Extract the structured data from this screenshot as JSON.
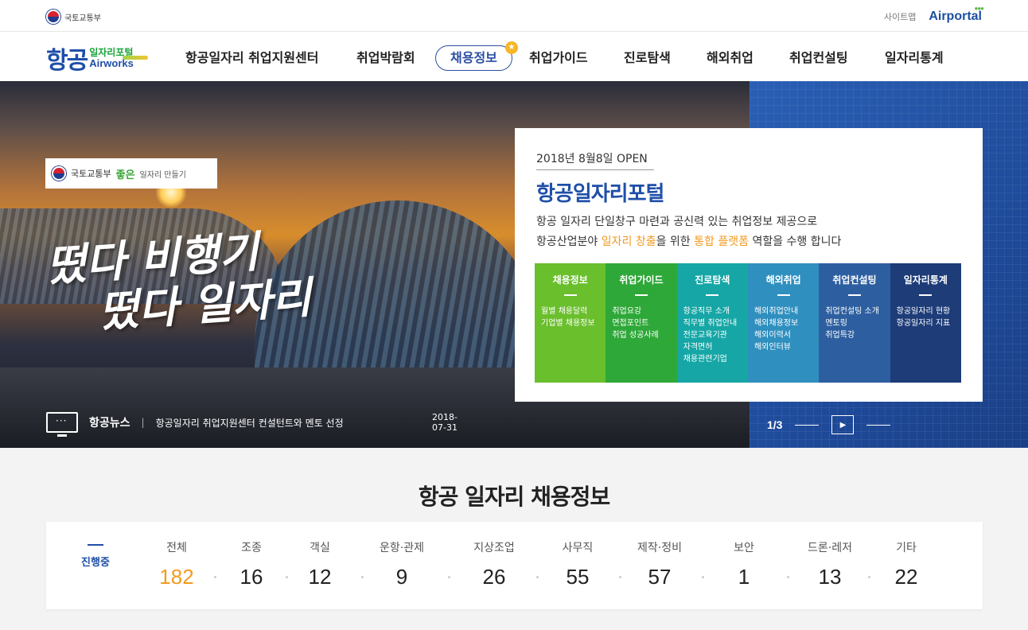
{
  "topbar": {
    "gov_label": "국토교통부",
    "sitemap": "사이트맵",
    "airportal": "Airportal"
  },
  "logo": {
    "main": "항공",
    "sub_kr": "일자리포털",
    "sub_en": "Airworks"
  },
  "nav": {
    "items": [
      {
        "label": "항공일자리 취업지원센터"
      },
      {
        "label": "취업박람회"
      },
      {
        "label": "채용정보",
        "active": true
      },
      {
        "label": "취업가이드"
      },
      {
        "label": "진로탐색"
      },
      {
        "label": "해외취업"
      },
      {
        "label": "취업컨설팅"
      },
      {
        "label": "일자리통계"
      }
    ]
  },
  "hero": {
    "badge_gov": "국토교통부",
    "badge_slogan": "좋은",
    "badge_slogan2": "일자리 만들기",
    "calligraphy_line1": "떴다 비행기",
    "calligraphy_line2": "떴다 일자리",
    "card": {
      "date": "2018년 8월8일 OPEN",
      "title": "항공일자리포털",
      "desc_line1": "항공 일자리 단일창구 마련과 공신력 있는 취업정보 제공으로",
      "desc_line2_a": "항공산업분야 ",
      "desc_line2_hl1": "일자리 창출",
      "desc_line2_b": "을 위한 ",
      "desc_line2_hl2": "통합 플랫폼",
      "desc_line2_c": " 역할을 수행 합니다",
      "columns": [
        {
          "title": "채용정보",
          "color": "#6abf2c",
          "items": [
            "월별 채용달력",
            "기업별 채용정보"
          ]
        },
        {
          "title": "취업가이드",
          "color": "#2ea838",
          "items": [
            "취업요강",
            "면접포인트",
            "취업 성공사례"
          ]
        },
        {
          "title": "진로탐색",
          "color": "#16a6a6",
          "items": [
            "항공직무 소개",
            "직무별 취업안내",
            "전문교육기관",
            "자격면허",
            "채용관련기업"
          ]
        },
        {
          "title": "해외취업",
          "color": "#2f8fbf",
          "items": [
            "해외취업안내",
            "해외채용정보",
            "해외이력서",
            "해외인터뷰"
          ]
        },
        {
          "title": "취업컨설팅",
          "color": "#2d5fa0",
          "items": [
            "취업컨설팅 소개",
            "멘토링",
            "취업특강"
          ]
        },
        {
          "title": "일자리통계",
          "color": "#1d3c78",
          "items": [
            "항공일자리 현황",
            "항공일자리 지표"
          ]
        }
      ]
    },
    "news": {
      "label": "항공뉴스",
      "headline": "항공일자리 취업지원센터 컨설턴트와 멘토 선정",
      "date": "2018-07-31"
    },
    "pager": {
      "current": "1/3"
    }
  },
  "jobs": {
    "title": "항공 일자리 채용정보",
    "status_label": "진행중",
    "categories": [
      {
        "label": "전체",
        "count": "182"
      },
      {
        "label": "조종",
        "count": "16"
      },
      {
        "label": "객실",
        "count": "12"
      },
      {
        "label": "운항·관제",
        "count": "9"
      },
      {
        "label": "지상조업",
        "count": "26"
      },
      {
        "label": "사무직",
        "count": "55"
      },
      {
        "label": "제작·정비",
        "count": "57"
      },
      {
        "label": "보안",
        "count": "1"
      },
      {
        "label": "드론·레저",
        "count": "13"
      },
      {
        "label": "기타",
        "count": "22"
      }
    ]
  }
}
